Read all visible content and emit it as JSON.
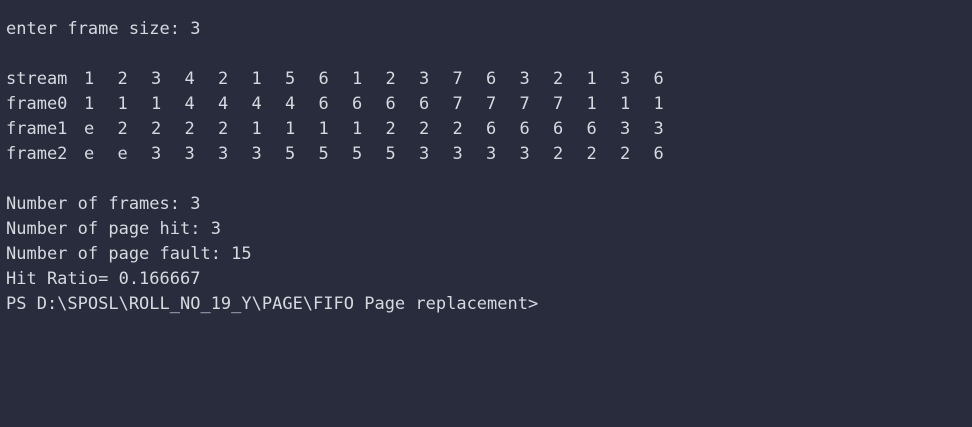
{
  "terminal": {
    "input_prompt": "enter frame size: 3",
    "table": [
      {
        "label": "stream",
        "cells": [
          "1",
          "2",
          "3",
          "4",
          "2",
          "1",
          "5",
          "6",
          "1",
          "2",
          "3",
          "7",
          "6",
          "3",
          "2",
          "1",
          "3",
          "6"
        ]
      },
      {
        "label": "frame0",
        "cells": [
          "1",
          "1",
          "1",
          "4",
          "4",
          "4",
          "4",
          "6",
          "6",
          "6",
          "6",
          "7",
          "7",
          "7",
          "7",
          "1",
          "1",
          "1"
        ]
      },
      {
        "label": "frame1",
        "cells": [
          "e",
          "2",
          "2",
          "2",
          "2",
          "1",
          "1",
          "1",
          "1",
          "2",
          "2",
          "2",
          "6",
          "6",
          "6",
          "6",
          "3",
          "3"
        ]
      },
      {
        "label": "frame2",
        "cells": [
          "e",
          "e",
          "3",
          "3",
          "3",
          "3",
          "5",
          "5",
          "5",
          "5",
          "3",
          "3",
          "3",
          "3",
          "2",
          "2",
          "2",
          "6"
        ]
      }
    ],
    "summary": {
      "frames": "Number of frames: 3",
      "page_hit": "Number of page hit: 3",
      "page_fault": "Number of page fault: 15",
      "hit_ratio": "Hit Ratio= 0.166667"
    },
    "shell_prompt": "PS D:\\SPOSL\\ROLL_NO_19_Y\\PAGE\\FIFO Page replacement>"
  },
  "colors": {
    "background": "#282c3c",
    "foreground": "#d6d9e0"
  }
}
